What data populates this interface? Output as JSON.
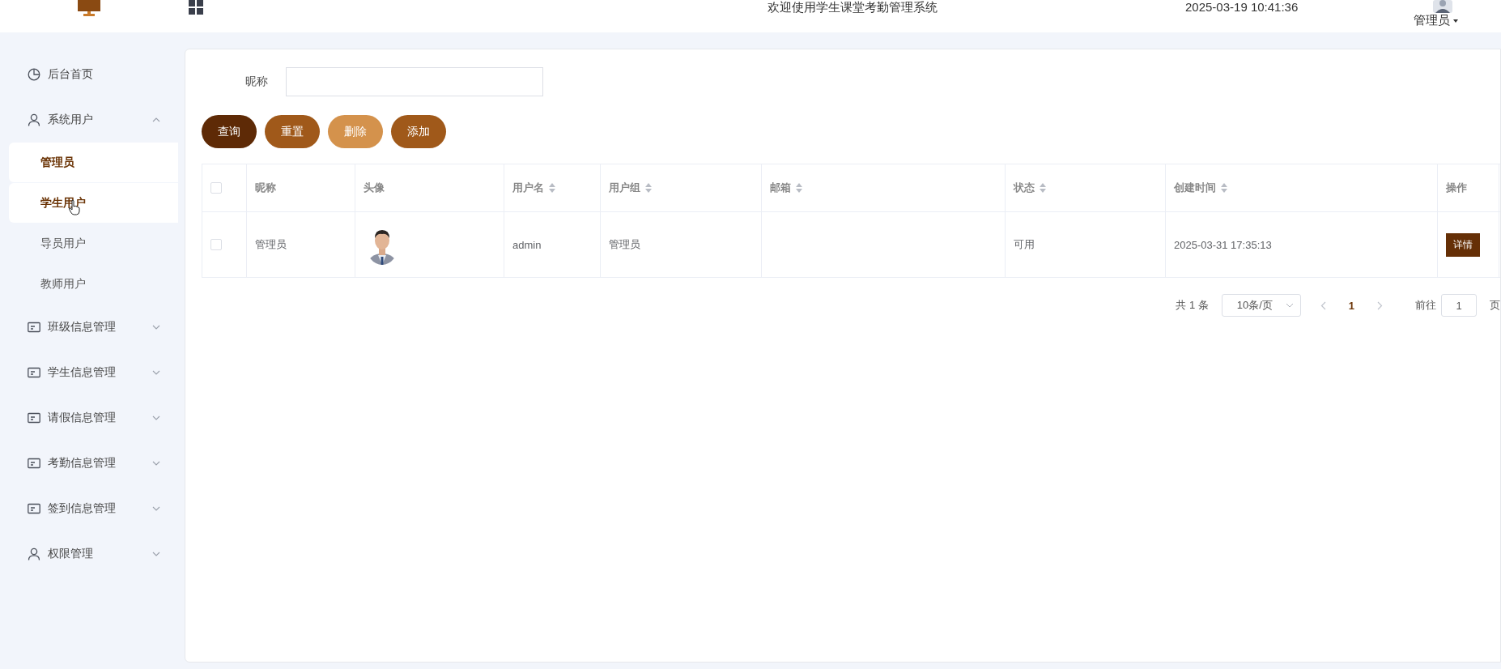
{
  "header": {
    "title": "欢迎使用学生课堂考勤管理系统",
    "datetime": "2025-03-19 10:41:36",
    "user": "管理员"
  },
  "sidebar": {
    "items": [
      {
        "label": "后台首页",
        "kind": "dashboard"
      },
      {
        "label": "系统用户",
        "kind": "user",
        "expanded": true,
        "children": [
          {
            "label": "管理员",
            "selected": true
          },
          {
            "label": "学生用户",
            "selected": true
          },
          {
            "label": "导员用户",
            "selected": false
          },
          {
            "label": "教师用户",
            "selected": false
          }
        ]
      },
      {
        "label": "班级信息管理",
        "kind": "card",
        "expanded": false
      },
      {
        "label": "学生信息管理",
        "kind": "card",
        "expanded": false
      },
      {
        "label": "请假信息管理",
        "kind": "card",
        "expanded": false
      },
      {
        "label": "考勤信息管理",
        "kind": "card",
        "expanded": false
      },
      {
        "label": "签到信息管理",
        "kind": "card",
        "expanded": false
      },
      {
        "label": "权限管理",
        "kind": "user",
        "expanded": false
      }
    ]
  },
  "search": {
    "label": "昵称"
  },
  "buttons": [
    {
      "label": "查询",
      "kind": "dark",
      "disabled": false
    },
    {
      "label": "重置",
      "kind": "normal",
      "disabled": false
    },
    {
      "label": "删除",
      "kind": "normal",
      "disabled": true
    },
    {
      "label": "添加",
      "kind": "normal",
      "disabled": false
    }
  ],
  "table": {
    "all_checked": false,
    "columns": [
      {
        "label": "昵称",
        "sortable": false
      },
      {
        "label": "头像",
        "sortable": false
      },
      {
        "label": "用户名",
        "sortable": true
      },
      {
        "label": "用户组",
        "sortable": true
      },
      {
        "label": "邮箱",
        "sortable": true
      },
      {
        "label": "状态",
        "sortable": true
      },
      {
        "label": "创建时间",
        "sortable": true
      },
      {
        "label": "操作",
        "sortable": false
      }
    ],
    "rows": [
      {
        "checked": false,
        "nickname": "管理员",
        "username": "admin",
        "group": "管理员",
        "status": "可用",
        "created": "2025-03-31 17:35:13",
        "action": "详情"
      }
    ]
  },
  "pagination": {
    "total": "共 1 条",
    "page_size": "10条/页",
    "pages": [
      {
        "label": "1",
        "selected": true
      }
    ],
    "goto_label": "前往",
    "goto_value": "1",
    "goto_suffix": "页"
  }
}
